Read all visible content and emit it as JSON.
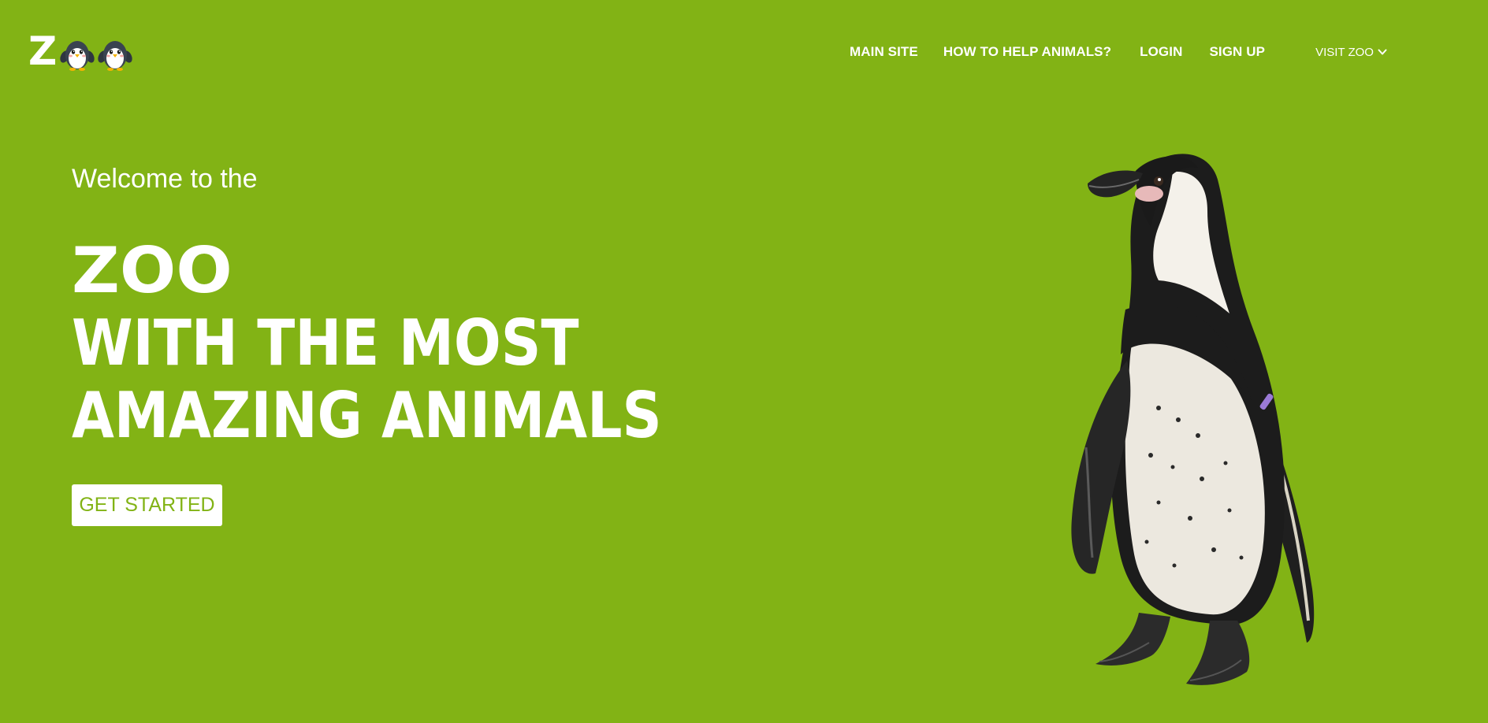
{
  "colors": {
    "background": "#82b315",
    "accent": "#82b315",
    "text_on_bg": "#ffffff"
  },
  "header": {
    "logo": {
      "letter": "Z",
      "icons": [
        "penguin-icon",
        "penguin-icon"
      ]
    },
    "nav": [
      "MAIN SITE",
      "HOW TO HELP ANIMALS?",
      "LOGIN",
      "SIGN UP"
    ],
    "visit": {
      "label": "VISIT ZOO",
      "icon": "chevron-down-icon"
    }
  },
  "hero": {
    "welcome": "Welcome to the",
    "headline": [
      "ZOO",
      "WITH THE MOST",
      "AMAZING ANIMALS"
    ],
    "cta_label": "GET STARTED",
    "image": "penguin-photo"
  }
}
